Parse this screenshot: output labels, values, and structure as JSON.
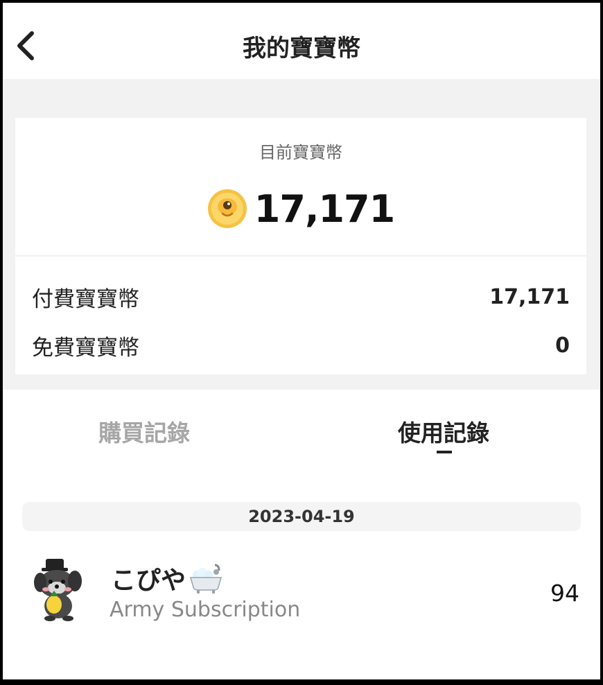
{
  "header": {
    "title": "我的寶寶幣"
  },
  "balance": {
    "label": "目前寶寶幣",
    "value": "17,171",
    "coin_icon": "coin-icon",
    "coin_color": "#f5b731"
  },
  "breakdown": [
    {
      "label": "付費寶寶幣",
      "value": "17,171"
    },
    {
      "label": "免費寶寶幣",
      "value": "0"
    }
  ],
  "tabs": [
    {
      "label": "購買記錄",
      "active": false
    },
    {
      "label": "使用記錄",
      "active": true
    }
  ],
  "history": {
    "date": "2023-04-19",
    "entries": [
      {
        "name": "こぴや",
        "emoji_icon": "bathtub-icon",
        "subtitle": "Army Subscription",
        "amount": "94"
      }
    ]
  }
}
